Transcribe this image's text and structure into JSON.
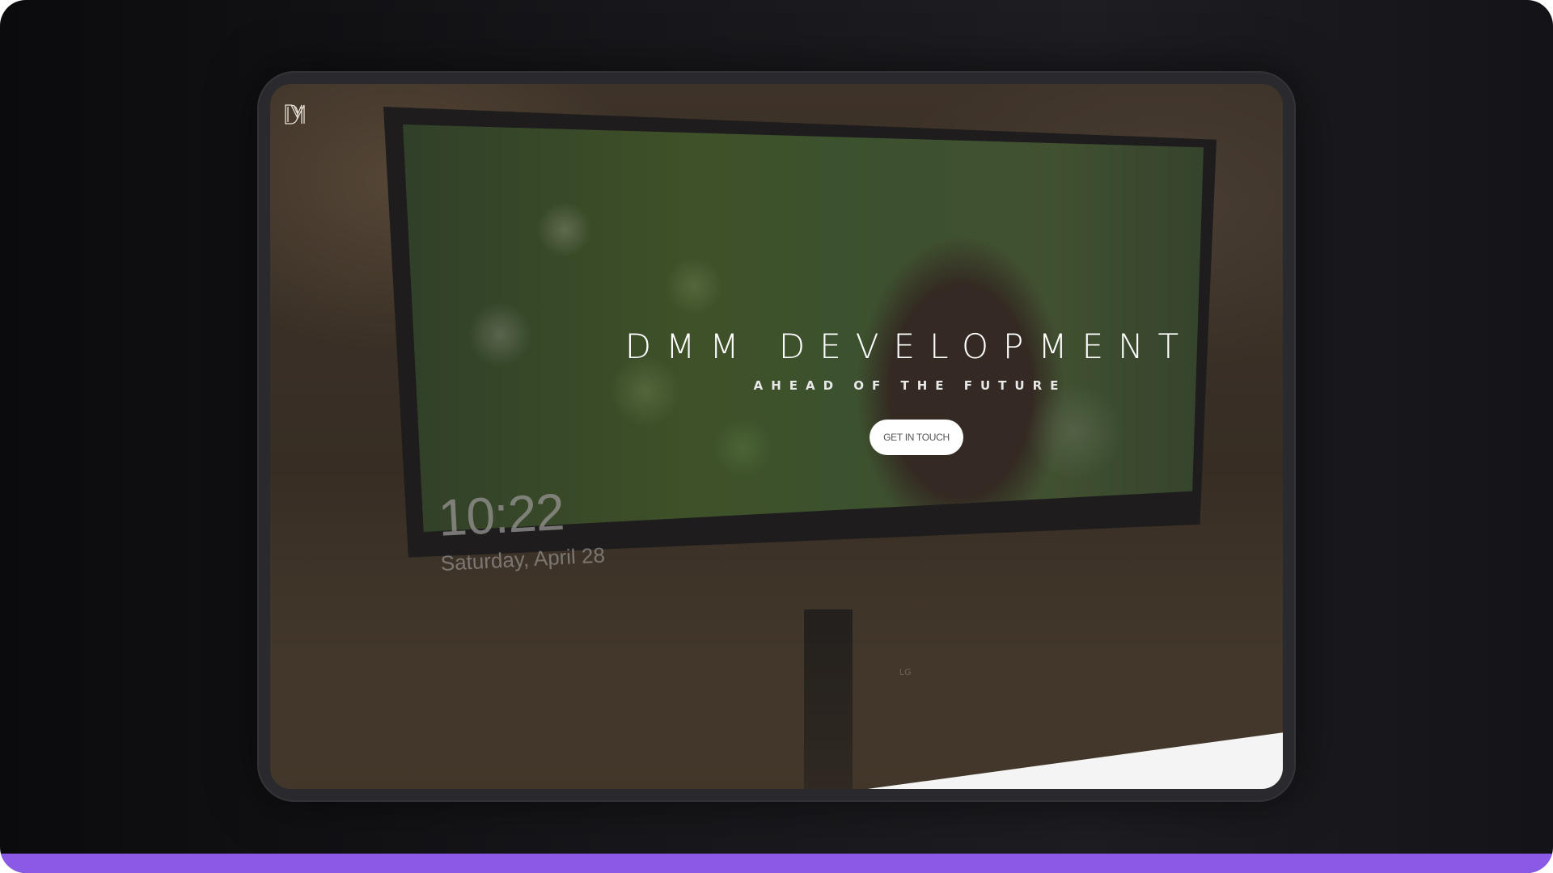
{
  "site": {
    "logo_alt": "DMM",
    "title": "DMM DEVELOPMENT",
    "tagline": "AHEAD OF THE FUTURE",
    "cta_label": "GET IN TOUCH"
  },
  "background_photo": {
    "clock_time": "10:22",
    "clock_date": "Saturday, April 28",
    "monitor_brand": "LG"
  },
  "colors": {
    "accent_bar": "#8a5ae6",
    "button_bg": "#ffffff",
    "slant_section": "#f4f4f4"
  }
}
